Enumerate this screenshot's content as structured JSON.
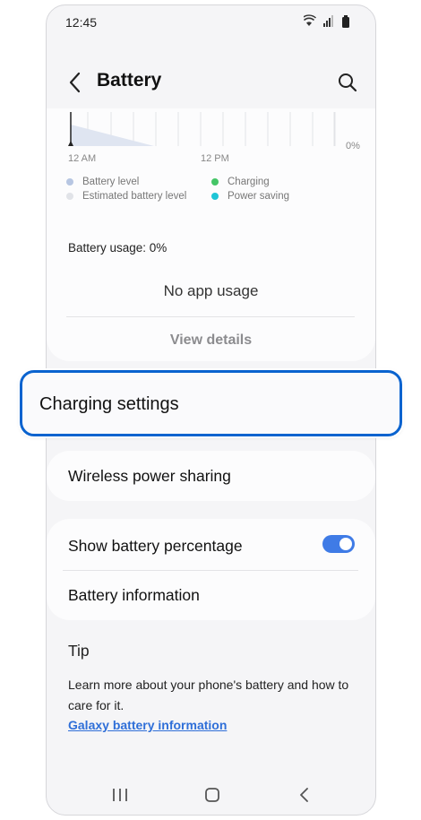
{
  "status_bar": {
    "time": "12:45"
  },
  "header": {
    "title": "Battery"
  },
  "chart": {
    "start_label": "12 AM",
    "mid_label": "12 PM",
    "percent_label": "0%"
  },
  "legend": {
    "battery_level": "Battery level",
    "estimated": "Estimated battery level",
    "charging": "Charging",
    "power_saving": "Power saving"
  },
  "colors": {
    "battery_level": "#b7c6e2",
    "estimated": "#e1e3e8",
    "charging": "#45c567",
    "power_saving": "#1ec5d6",
    "highlight": "#0a63cf",
    "toggle_on": "#3f7be6",
    "link": "#2f6fd8"
  },
  "usage": {
    "label": "Battery usage: 0%",
    "empty_text": "No app usage",
    "view_details": "View details"
  },
  "charging_settings": {
    "label": "Charging settings"
  },
  "wireless": {
    "label": "Wireless power sharing"
  },
  "settings": {
    "show_percentage": {
      "label": "Show battery percentage",
      "enabled": true
    },
    "battery_info": {
      "label": "Battery information"
    }
  },
  "tip": {
    "title": "Tip",
    "text": "Learn more about your phone's battery and how to care for it.",
    "link": "Galaxy battery information"
  },
  "nav": {
    "recents_icon": "recents-icon",
    "home_icon": "home-icon",
    "back_icon": "back-icon"
  }
}
